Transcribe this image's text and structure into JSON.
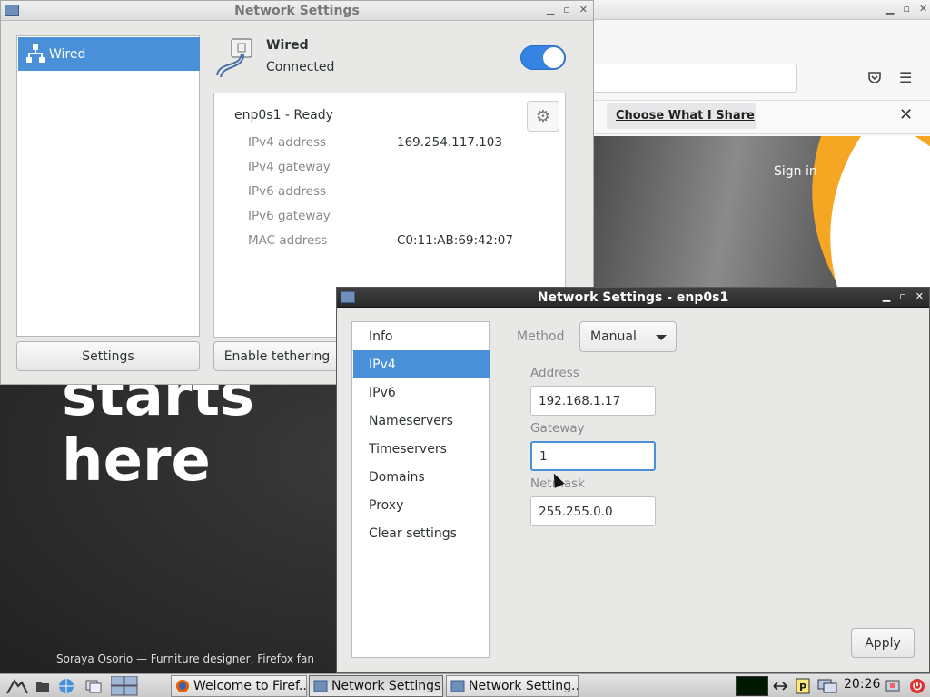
{
  "firefox": {
    "notice_button": "Choose What I Share",
    "signin": "Sign in",
    "hero_line1": "starts",
    "hero_line2": "here",
    "caption": "Soraya Osorio — Furniture designer, Firefox fan",
    "icons": {
      "pocket": "pocket-icon",
      "menu": "hamburger-menu-icon",
      "close": "close-icon"
    }
  },
  "network_main": {
    "title": "Network Settings",
    "list": [
      {
        "label": "Wired",
        "icon": "network-wired-icon",
        "selected": true
      }
    ],
    "header": {
      "name": "Wired",
      "status": "Connected",
      "toggle_on": true
    },
    "details": {
      "device": "enp0s1 - Ready",
      "rows": [
        {
          "key": "IPv4 address",
          "value": "169.254.117.103"
        },
        {
          "key": "IPv4 gateway",
          "value": ""
        },
        {
          "key": "IPv6 address",
          "value": ""
        },
        {
          "key": "IPv6 gateway",
          "value": ""
        },
        {
          "key": "MAC address",
          "value": "C0:11:AB:69:42:07"
        }
      ]
    },
    "buttons": {
      "settings": "Settings",
      "tethering": "Enable tethering"
    }
  },
  "network_dialog": {
    "title": "Network Settings - enp0s1",
    "nav": [
      "Info",
      "IPv4",
      "IPv6",
      "Nameservers",
      "Timeservers",
      "Domains",
      "Proxy",
      "Clear settings"
    ],
    "nav_active": "IPv4",
    "method_label": "Method",
    "method_value": "Manual",
    "fields": {
      "address_label": "Address",
      "address_value": "192.168.1.17",
      "gateway_label": "Gateway",
      "gateway_value": "1",
      "netmask_label": "Netmask",
      "netmask_value": "255.255.0.0"
    },
    "apply": "Apply"
  },
  "taskbar": {
    "tasks": [
      "Welcome to Firef...",
      "Network Settings",
      "Network Setting..."
    ],
    "clock": "20:26"
  },
  "colors": {
    "accent": "#4a90d9",
    "toggle": "#3584e4",
    "dialog_titlebar": "#2f2f2f",
    "orange": "#f5a623"
  }
}
